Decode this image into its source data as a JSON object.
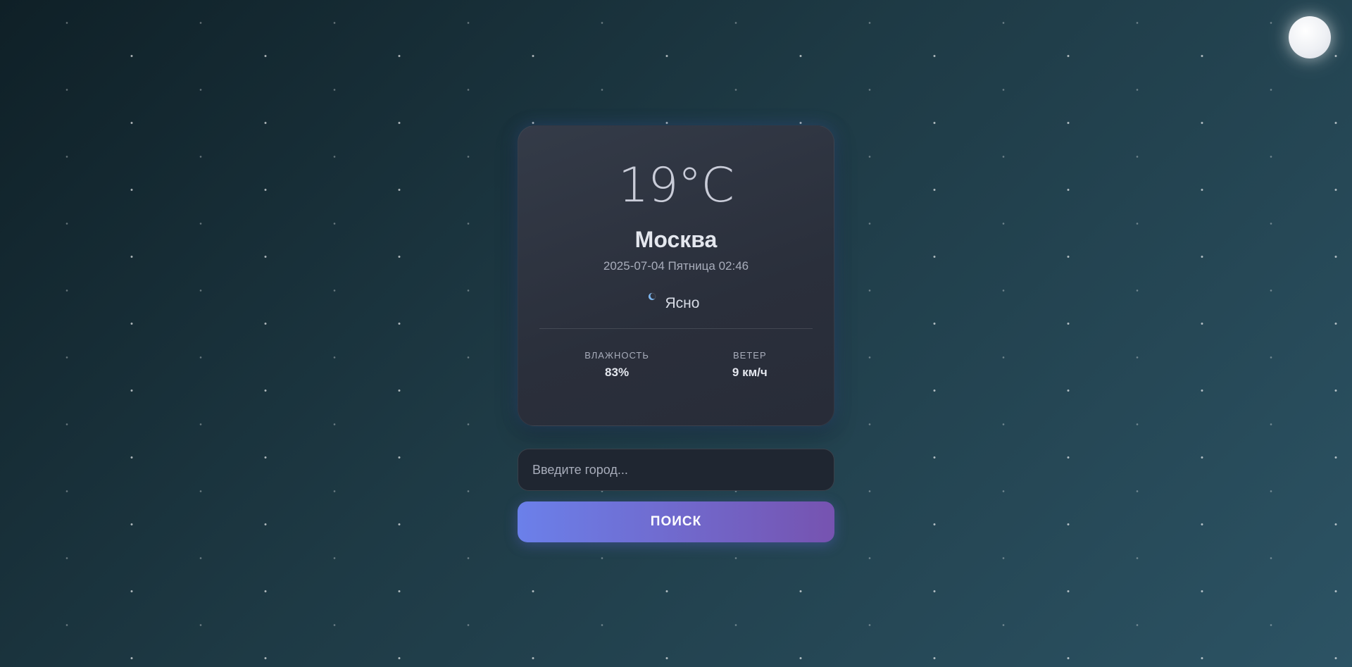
{
  "weather": {
    "temperature": "19°C",
    "city": "Москва",
    "datetime": "2025-07-04 Пятница 02:46",
    "condition": "Ясно",
    "condition_icon": "crescent-moon-icon",
    "humidity_label": "ВЛАЖНОСТЬ",
    "humidity_value": "83%",
    "wind_label": "ВЕТЕР",
    "wind_value": "9 км/ч"
  },
  "search": {
    "placeholder": "Введите город...",
    "value": "",
    "button_label": "ПОИСК"
  },
  "theme": {
    "background_start": "#0f2027",
    "background_end": "#2c5364",
    "card": "#2d323e",
    "button_gradient_start": "#6b80ea",
    "button_gradient_end": "#7653b0",
    "moon_icon": "full-moon-icon"
  }
}
